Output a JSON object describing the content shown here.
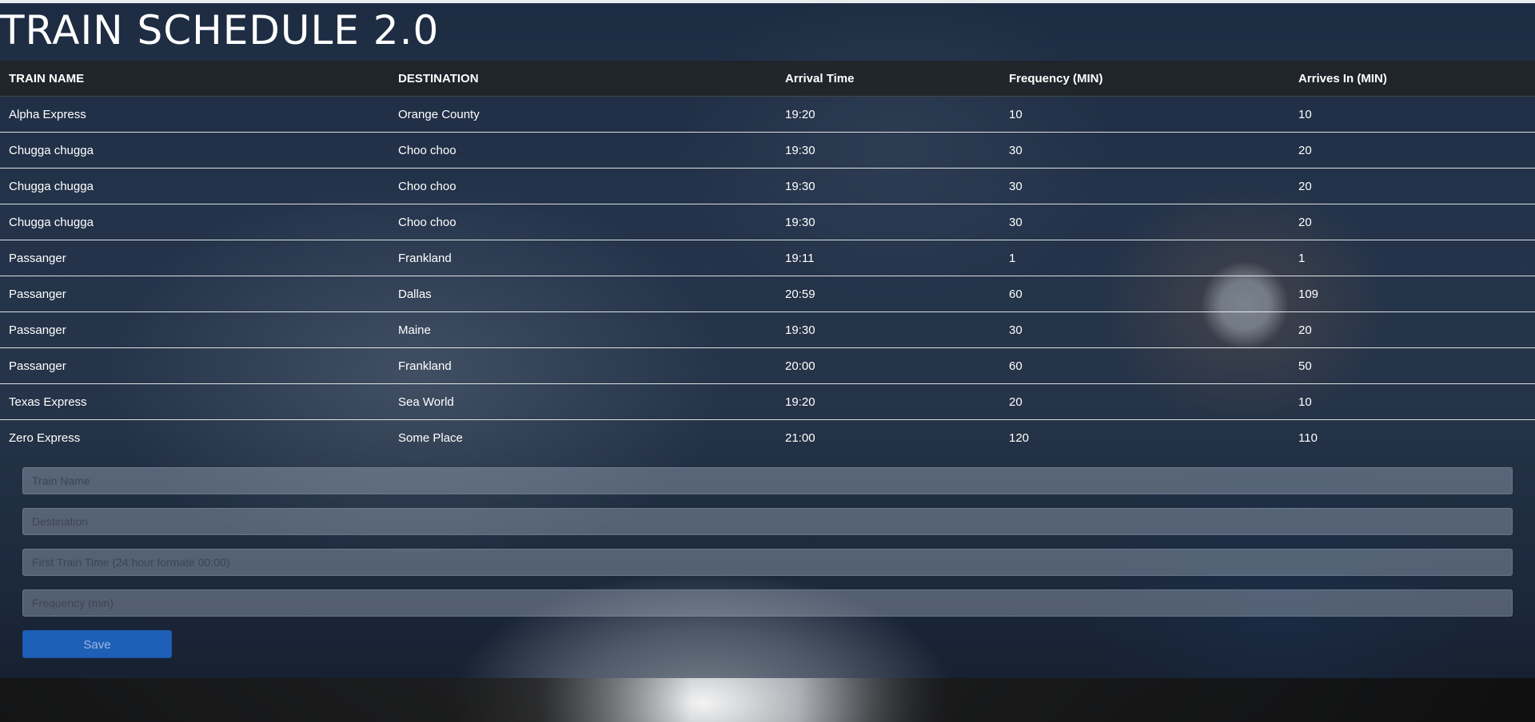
{
  "header": {
    "title": "TRAIN SCHEDULE 2.0"
  },
  "table": {
    "columns": [
      "TRAIN NAME",
      "DESTINATION",
      "Arrival Time",
      "Frequency (MIN)",
      "Arrives In (MIN)"
    ],
    "rows": [
      [
        "Alpha Express",
        "Orange County",
        "19:20",
        "10",
        "10"
      ],
      [
        "Chugga chugga",
        "Choo choo",
        "19:30",
        "30",
        "20"
      ],
      [
        "Chugga chugga",
        "Choo choo",
        "19:30",
        "30",
        "20"
      ],
      [
        "Chugga chugga",
        "Choo choo",
        "19:30",
        "30",
        "20"
      ],
      [
        "Passanger",
        "Frankland",
        "19:11",
        "1",
        "1"
      ],
      [
        "Passanger",
        "Dallas",
        "20:59",
        "60",
        "109"
      ],
      [
        "Passanger",
        "Maine",
        "19:30",
        "30",
        "20"
      ],
      [
        "Passanger",
        "Frankland",
        "20:00",
        "60",
        "50"
      ],
      [
        "Texas Express",
        "Sea World",
        "19:20",
        "20",
        "10"
      ],
      [
        "Zero Express",
        "Some Place",
        "21:00",
        "120",
        "110"
      ]
    ]
  },
  "form": {
    "train_name_placeholder": "Train Name",
    "destination_placeholder": "Destination",
    "first_time_placeholder": "First Train Time (24 hour formate 00:00)",
    "frequency_placeholder": "Frequency (min)",
    "save_label": "Save"
  },
  "colors": {
    "header_row": "#212529",
    "save_button": "#1e5fb8",
    "overlay": "#122137"
  }
}
